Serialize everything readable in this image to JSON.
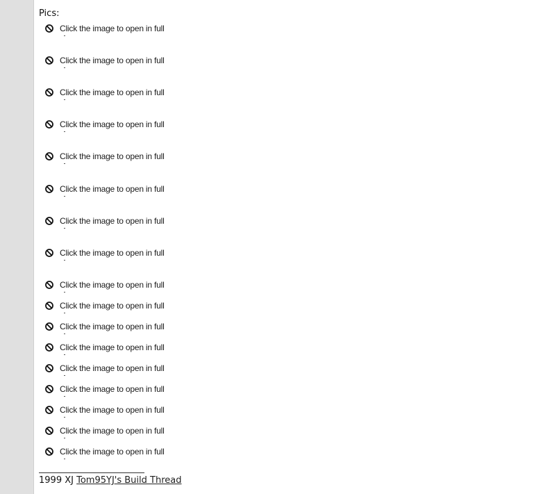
{
  "post": {
    "pics_label": "Pics:",
    "attachment_link_text": "Click the image to open in full",
    "attachment_icon": "blocked-image-icon",
    "attachment_count": 17,
    "signature": {
      "prefix": "1999 XJ",
      "link_text": "Tom95YJ's Build Thread"
    }
  }
}
